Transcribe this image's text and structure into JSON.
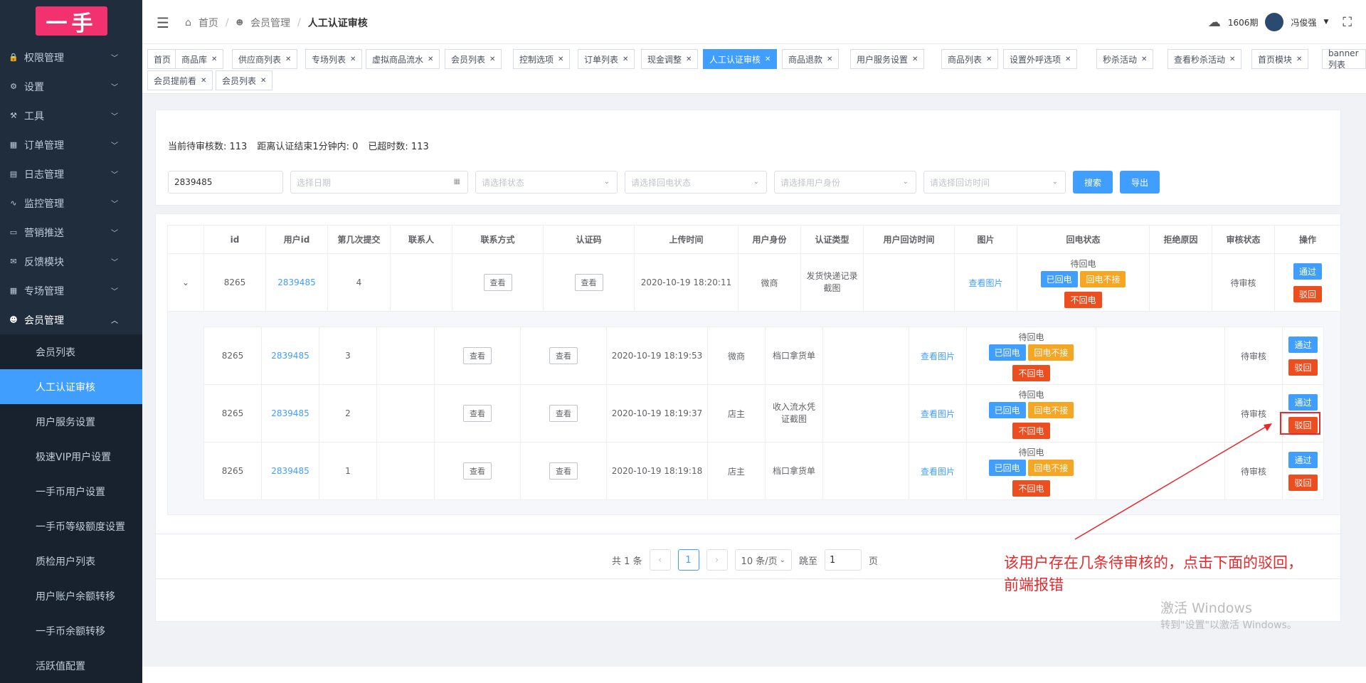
{
  "sidebar": {
    "logo": "一手",
    "menus": [
      {
        "label": "权限管理",
        "icon": "lock-icon",
        "glyph": "🔒"
      },
      {
        "label": "设置",
        "icon": "gear-icon",
        "glyph": "⚙"
      },
      {
        "label": "工具",
        "icon": "tool-icon",
        "glyph": "⚒"
      },
      {
        "label": "订单管理",
        "icon": "list-icon",
        "glyph": "▦"
      },
      {
        "label": "日志管理",
        "icon": "log-icon",
        "glyph": "▤"
      },
      {
        "label": "监控管理",
        "icon": "pulse-icon",
        "glyph": "∿"
      },
      {
        "label": "营销推送",
        "icon": "card-icon",
        "glyph": "▭"
      },
      {
        "label": "反馈模块",
        "icon": "mail-icon",
        "glyph": "✉"
      },
      {
        "label": "专场管理",
        "icon": "grid-icon",
        "glyph": "▦"
      },
      {
        "label": "会员管理",
        "icon": "users-icon",
        "glyph": "☻"
      }
    ],
    "submenu": [
      "会员列表",
      "人工认证审核",
      "用户服务设置",
      "极速VIP用户设置",
      "一手币用户设置",
      "一手币等级额度设置",
      "质检用户列表",
      "用户账户余额转移",
      "一手币余额转移",
      "活跃值配置"
    ]
  },
  "topbar": {
    "crumb_home": "首页",
    "crumb_member": "会员管理",
    "crumb_current": "人工认证审核",
    "period": "1606期",
    "user": "冯俊强"
  },
  "tabs": [
    "首页",
    "商品库",
    "供应商列表",
    "专场列表",
    "虚拟商品流水",
    "会员列表",
    "控制选项",
    "订单列表",
    "现金调整",
    "人工认证审核",
    "商品退款",
    "用户服务设置",
    "商品列表",
    "设置外呼选项",
    "秒杀活动",
    "查看秒杀活动",
    "首页模块",
    "banner列表",
    "会员提前看",
    "会员列表"
  ],
  "stats": {
    "pending": "当前待审核数: 113",
    "within_min": "距离认证结束1分钟内: 0",
    "overtime": "已超时数: 113"
  },
  "filters": {
    "user_id_value": "2839485",
    "date_placeholder": "选择日期",
    "status_placeholder": "请选择状态",
    "callback_placeholder": "请选择回电状态",
    "identity_placeholder": "请选择用户身份",
    "visit_time_placeholder": "请选择回访时间",
    "search_label": "搜索",
    "export_label": "导出"
  },
  "table": {
    "headers": [
      "id",
      "用户id",
      "第几次提交",
      "联系人",
      "联系方式",
      "认证码",
      "上传时间",
      "用户身份",
      "认证类型",
      "用户回访时间",
      "图片",
      "回电状态",
      "拒绝原因",
      "审核状态",
      "操作"
    ],
    "main_row": {
      "id": "8265",
      "user_id": "2839485",
      "submit": "4",
      "upload_time": "2020-10-19 18:20:11",
      "identity": "微商",
      "cert_type": "发货快递记录截图",
      "audit": "待审核"
    },
    "view_label": "查看",
    "view_image": "查看图片",
    "callback_pending": "待回电",
    "tag_called": "已回电",
    "tag_no_answer": "回电不接",
    "tag_no_call": "不回电",
    "approve": "通过",
    "reject": "驳回"
  },
  "sub_rows": [
    {
      "id": "8265",
      "user_id": "2839485",
      "submit": "3",
      "upload_time": "2020-10-19 18:19:53",
      "identity": "微商",
      "cert_type": "档口拿货单",
      "audit": "待审核"
    },
    {
      "id": "8265",
      "user_id": "2839485",
      "submit": "2",
      "upload_time": "2020-10-19 18:19:37",
      "identity": "店主",
      "cert_type": "收入流水凭证截图",
      "audit": "待审核"
    },
    {
      "id": "8265",
      "user_id": "2839485",
      "submit": "1",
      "upload_time": "2020-10-19 18:19:18",
      "identity": "店主",
      "cert_type": "档口拿货单",
      "audit": "待审核"
    }
  ],
  "pager": {
    "total": "共 1 条",
    "page": "1",
    "size": "10 条/页",
    "goto": "跳至",
    "goto_value": "1",
    "page_suffix": "页"
  },
  "annotation": {
    "line1": "该用户存在几条待审核的，点击下面的驳回，",
    "line2": "前端报错"
  },
  "watermark": {
    "line1": "激活 Windows",
    "line2": "转到\"设置\"以激活 Windows。"
  },
  "colors": {
    "accent": "#409eff",
    "danger": "#ec4e20",
    "warning": "#f5a623",
    "sidebar": "#1f2d3d",
    "logo": "#f2316f",
    "annotation": "#e8282b"
  }
}
